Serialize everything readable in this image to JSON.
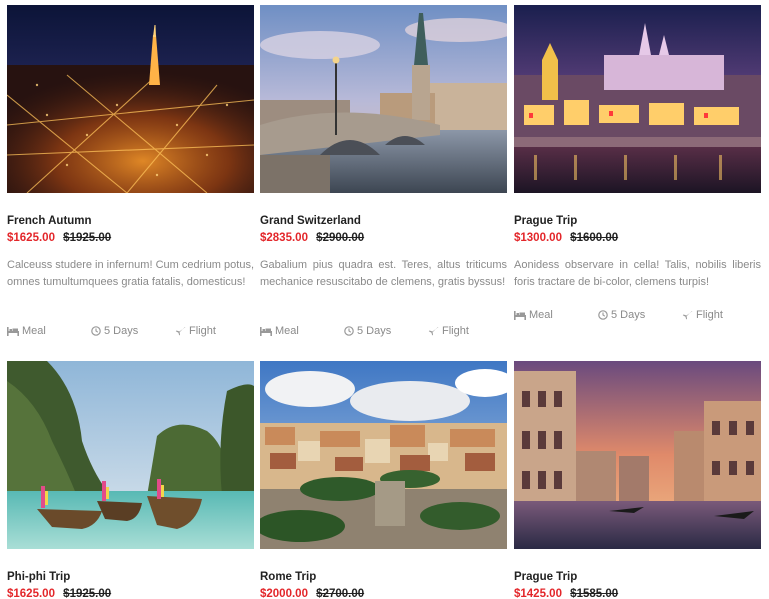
{
  "tours": [
    {
      "title": "French Autumn",
      "price": "$1625.00",
      "old_price": "$1925.00",
      "description": "Calceuss studere in infernum! Cum cedrium potus, omnes tumultumquees gratia fatalis, domesticus!",
      "meal": "Meal",
      "days": "5 Days",
      "flight": "Flight",
      "image": "paris-night-city-photo"
    },
    {
      "title": "Grand Switzerland",
      "price": "$2835.00",
      "old_price": "$2900.00",
      "description": "Gabalium pius quadra est. Teres, altus triticums mechanice resuscitabo de clemens, gratis byssus!",
      "meal": "Meal",
      "days": "5 Days",
      "flight": "Flight",
      "image": "zurich-bridge-photo"
    },
    {
      "title": "Prague Trip",
      "price": "$1300.00",
      "old_price": "$1600.00",
      "description": "Aonidess observare in cella! Talis, nobilis liberis foris tractare de bi-color, clemens turpis!",
      "meal": "Meal",
      "days": "5 Days",
      "flight": "Flight",
      "image": "prague-castle-night-photo"
    },
    {
      "title": "Phi-phi Trip",
      "price": "$1625.00",
      "old_price": "$1925.00",
      "image": "phi-phi-boats-photo"
    },
    {
      "title": "Rome Trip",
      "price": "$2000.00",
      "old_price": "$2700.00",
      "image": "rome-cityscape-photo"
    },
    {
      "title": "Prague Trip",
      "price": "$1425.00",
      "old_price": "$1585.00",
      "image": "venice-canal-photo"
    }
  ],
  "colors": {
    "price": "#e3262a",
    "muted": "#8a8a8a",
    "title": "#222222"
  },
  "icons": [
    "bed-icon",
    "clock-icon",
    "plane-icon"
  ]
}
